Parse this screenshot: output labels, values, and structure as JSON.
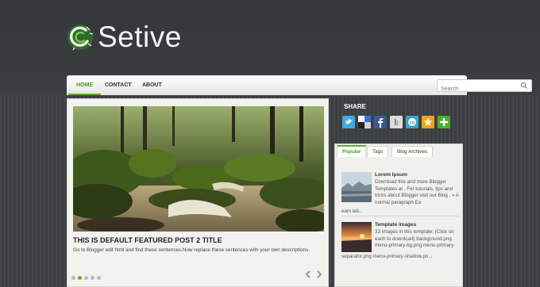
{
  "site": {
    "title": "Setive"
  },
  "nav": {
    "items": [
      {
        "label": "HOME",
        "active": true
      },
      {
        "label": "CONTACT",
        "active": false
      },
      {
        "label": "ABOUT",
        "active": false
      }
    ],
    "search_placeholder": "Search"
  },
  "featured": {
    "title": "THIS IS DEFAULT FEATURED POST 2 TITLE",
    "description": "Go to Blogger edit html and find these sentences.Now replace these sentences with your own descriptions.",
    "slide_count": 5,
    "active_slide": 2
  },
  "sidebar": {
    "share_heading": "SHARE",
    "share_icons": [
      "twitter-icon",
      "delicious-icon",
      "facebook-icon",
      "digg-icon",
      "stumbleupon-icon",
      "favorites-star-icon",
      "add-icon"
    ],
    "tabs": [
      {
        "label": "Popular",
        "active": true
      },
      {
        "label": "Tags",
        "active": false
      },
      {
        "label": "Blog Archives",
        "active": false
      }
    ],
    "posts": [
      {
        "title": "Lorem Ipsum",
        "text": "Download this and more Blogger Templates at . For tutorials, tips and tricks about Blogger visit our Blog . » A normal paragraph Ea",
        "text_overflow": "eam lab..."
      },
      {
        "title": "Template images",
        "text": "33 Images in this template: (Click on each to download) background.png menu-primary-bg.png menu-primary-",
        "text_overflow": "separator.png menu-primary-shadow.pn..."
      }
    ]
  },
  "colors": {
    "accent": "#5bb21f",
    "header_bg": "#34373a",
    "content_bg": "#f2f3ef"
  }
}
